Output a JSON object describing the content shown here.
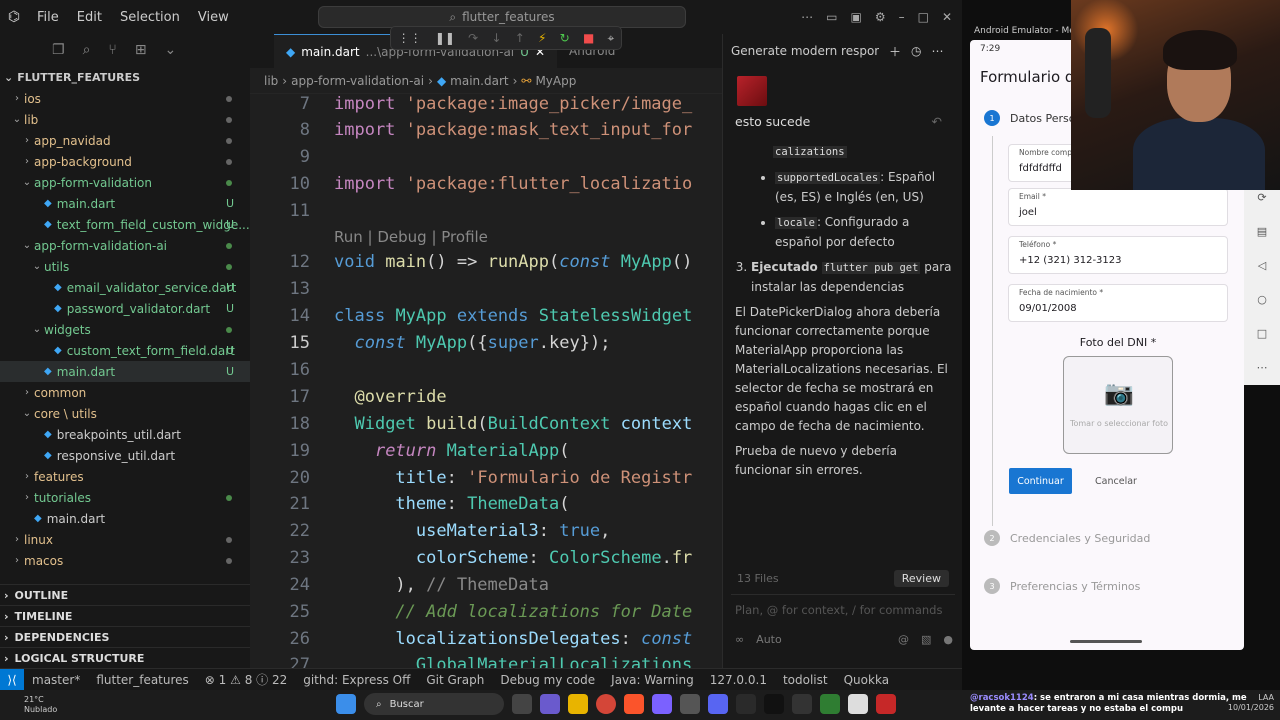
{
  "window": {
    "menu": [
      "File",
      "Edit",
      "Selection",
      "View"
    ],
    "search_text": "flutter_features"
  },
  "sidebar": {
    "root": "FLUTTER_FEATURES",
    "tree": [
      {
        "label": "ios",
        "indent": 1,
        "kind": "folder-collapsed",
        "badge": "",
        "dot": "grey"
      },
      {
        "label": "lib",
        "indent": 1,
        "kind": "folder-open",
        "badge": "",
        "dot": "grey"
      },
      {
        "label": "app_navidad",
        "indent": 2,
        "kind": "folder-collapsed",
        "badge": "",
        "dot": "grey"
      },
      {
        "label": "app-background",
        "indent": 2,
        "kind": "folder-collapsed",
        "badge": "",
        "dot": "grey"
      },
      {
        "label": "app-form-validation",
        "indent": 2,
        "kind": "folder-open",
        "badge": "",
        "dot": "green"
      },
      {
        "label": "main.dart",
        "indent": 3,
        "kind": "dart",
        "badge": "U",
        "dot": ""
      },
      {
        "label": "text_form_field_custom_widge...",
        "indent": 3,
        "kind": "dart",
        "badge": "U",
        "dot": ""
      },
      {
        "label": "app-form-validation-ai",
        "indent": 2,
        "kind": "folder-open",
        "badge": "",
        "dot": "green"
      },
      {
        "label": "utils",
        "indent": 3,
        "kind": "folder-open",
        "badge": "",
        "dot": "green"
      },
      {
        "label": "email_validator_service.dart",
        "indent": 4,
        "kind": "dart",
        "badge": "U",
        "dot": ""
      },
      {
        "label": "password_validator.dart",
        "indent": 4,
        "kind": "dart",
        "badge": "U",
        "dot": ""
      },
      {
        "label": "widgets",
        "indent": 3,
        "kind": "folder-open",
        "badge": "",
        "dot": "green"
      },
      {
        "label": "custom_text_form_field.dart",
        "indent": 4,
        "kind": "dart",
        "badge": "U",
        "dot": ""
      },
      {
        "label": "main.dart",
        "indent": 3,
        "kind": "dart",
        "badge": "U",
        "dot": "",
        "selected": true
      },
      {
        "label": "common",
        "indent": 2,
        "kind": "folder-collapsed",
        "badge": "",
        "dot": ""
      },
      {
        "label": "core \\ utils",
        "indent": 2,
        "kind": "folder-open",
        "badge": "",
        "dot": ""
      },
      {
        "label": "breakpoints_util.dart",
        "indent": 3,
        "kind": "dart",
        "badge": "",
        "dot": ""
      },
      {
        "label": "responsive_util.dart",
        "indent": 3,
        "kind": "dart",
        "badge": "",
        "dot": ""
      },
      {
        "label": "features",
        "indent": 2,
        "kind": "folder-collapsed",
        "badge": "",
        "dot": ""
      },
      {
        "label": "tutoriales",
        "indent": 2,
        "kind": "folder-collapsed",
        "badge": "",
        "dot": "green"
      },
      {
        "label": "main.dart",
        "indent": 2,
        "kind": "dart",
        "badge": "",
        "dot": ""
      },
      {
        "label": "linux",
        "indent": 1,
        "kind": "folder-collapsed",
        "badge": "",
        "dot": "grey"
      },
      {
        "label": "macos",
        "indent": 1,
        "kind": "folder-collapsed",
        "badge": "",
        "dot": "grey"
      }
    ],
    "sections": [
      "OUTLINE",
      "TIMELINE",
      "DEPENDENCIES",
      "LOGICAL STRUCTURE"
    ]
  },
  "editor": {
    "tab_file": "main.dart",
    "tab_path": "...\\app-form-validation-ai",
    "tab_badge": "U",
    "tab2": "Android",
    "breadcrumb": [
      "lib",
      "app-form-validation-ai",
      "main.dart",
      "MyApp"
    ],
    "codelens": "Run | Debug | Profile",
    "line_numbers": [
      "7",
      "8",
      "9",
      "10",
      "11",
      "",
      "12",
      "13",
      "14",
      "15",
      "16",
      "17",
      "18",
      "19",
      "20",
      "21",
      "22",
      "23",
      "24",
      "25",
      "26",
      "27"
    ]
  },
  "chat": {
    "header_title": "Generate modern responsive",
    "user_message": "esto sucede",
    "bullets": [
      {
        "code": "calizations",
        "text": ""
      },
      {
        "code": "supportedLocales",
        "text": ": Español (es, ES) e Inglés (en, US)"
      },
      {
        "code": "locale",
        "text": ": Configurado a español por defecto"
      }
    ],
    "step3_label": "Ejecutado",
    "step3_code": "flutter pub get",
    "step3_text": "para instalar las dependencias",
    "para1": "El DatePickerDialog ahora debería funcionar correctamente porque MaterialApp proporciona las MaterialLocalizations necesarias. El selector de fecha se mostrará en español cuando hagas clic en el campo de fecha de nacimiento.",
    "para2": "Prueba de nuevo y debería funcionar sin errores.",
    "files": "13 Files",
    "review_label": "Review",
    "input_placeholder": "Plan, @ for context, / for commands",
    "mode": "Auto"
  },
  "statusbar": {
    "items": [
      "master*",
      "flutter_features",
      "⊗ 1  ⚠ 8  ⓘ 22",
      "githd: Express Off",
      "Git Graph",
      "Debug my code",
      "Java: Warning",
      "127.0.0.1",
      "todolist",
      "Quokka"
    ]
  },
  "taskbar": {
    "weather_temp": "21°C",
    "weather_desc": "Nublado",
    "search_label": "Buscar",
    "chat_nick": "@racsok1124",
    "chat_msg": ": se entraron a mi casa mientras dormia, me levante a hacer tareas y no estaba el compu",
    "lang": "LAA",
    "date": "10/01/2026"
  },
  "emulator": {
    "window_title": "Android Emulator - Mediu",
    "status_time": "7:29",
    "app_title": "Formulario de",
    "steps": [
      {
        "num": "1",
        "label": "Datos Perso"
      },
      {
        "num": "2",
        "label": "Credenciales y Seguridad"
      },
      {
        "num": "3",
        "label": "Preferencias y Términos"
      }
    ],
    "fields": [
      {
        "label": "Nombre comp",
        "value": "fdfdfdffd"
      },
      {
        "label": "Email *",
        "value": "joel"
      },
      {
        "label": "Teléfono *",
        "value": "+12 (321) 312-3123"
      },
      {
        "label": "Fecha de nacimiento *",
        "value": "09/01/2008"
      }
    ],
    "dni_title": "Foto del DNI *",
    "dni_hint": "Tomar o seleccionar foto",
    "continue": "Continuar",
    "cancel": "Cancelar"
  }
}
